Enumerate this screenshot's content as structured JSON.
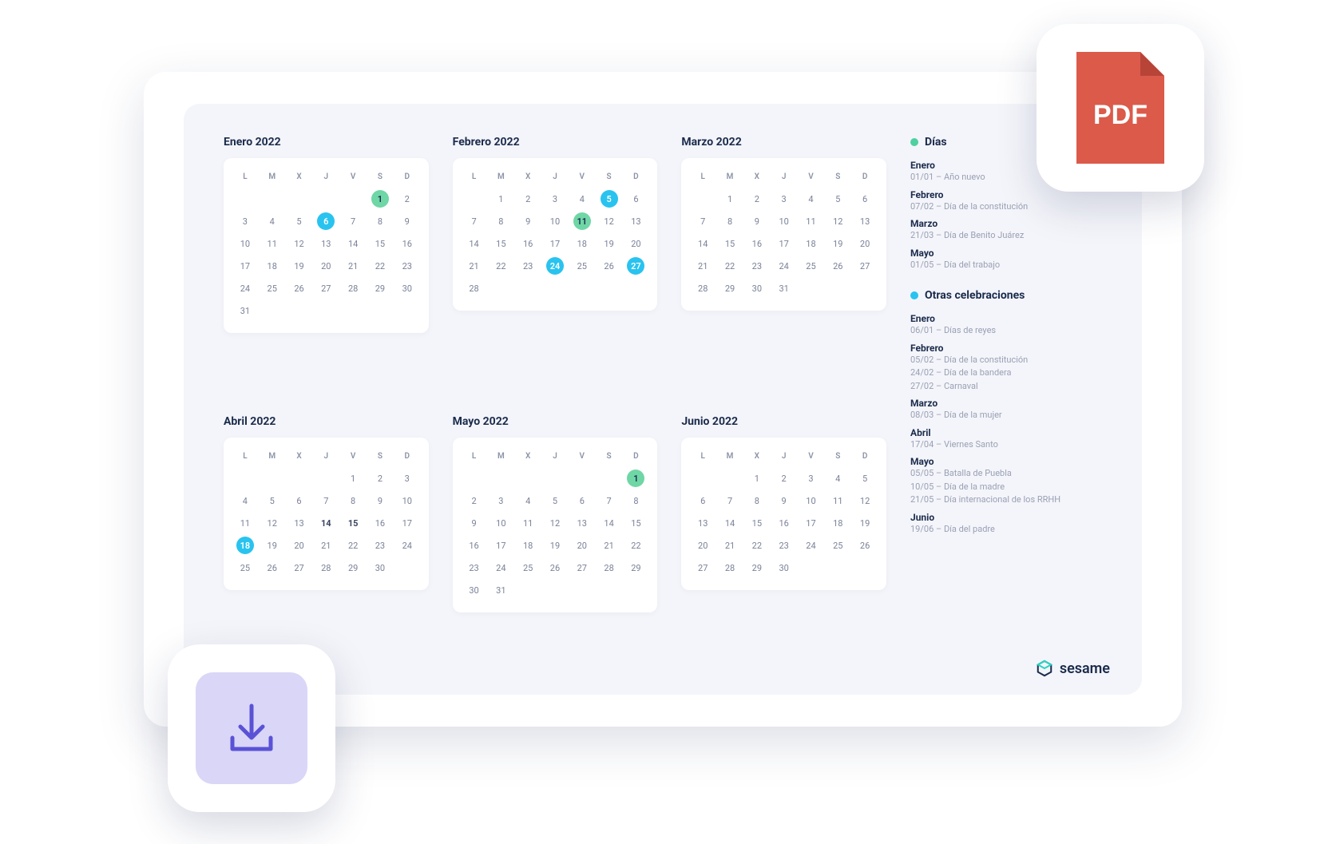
{
  "dow": [
    "L",
    "M",
    "X",
    "J",
    "V",
    "S",
    "D"
  ],
  "colors": {
    "green": "#6fd6a5",
    "blue": "#29c3ef"
  },
  "months": [
    {
      "title": "Enero 2022",
      "startDow": 5,
      "numDays": 31,
      "highlights": [
        {
          "day": 1,
          "color": "green"
        },
        {
          "day": 6,
          "color": "blue"
        }
      ]
    },
    {
      "title": "Febrero 2022",
      "startDow": 1,
      "numDays": 28,
      "highlights": [
        {
          "day": 5,
          "color": "blue"
        },
        {
          "day": 11,
          "color": "green"
        },
        {
          "day": 24,
          "color": "blue"
        },
        {
          "day": 27,
          "color": "blue"
        }
      ]
    },
    {
      "title": "Marzo 2022",
      "startDow": 1,
      "numDays": 31,
      "highlights": []
    },
    {
      "title": "Abril 2022",
      "startDow": 4,
      "numDays": 30,
      "boldDays": [
        14,
        15
      ],
      "highlights": [
        {
          "day": 18,
          "color": "blue"
        }
      ]
    },
    {
      "title": "Mayo 2022",
      "startDow": 6,
      "numDays": 31,
      "highlights": [
        {
          "day": 1,
          "color": "green"
        }
      ]
    },
    {
      "title": "Junio 2022",
      "startDow": 2,
      "numDays": 30,
      "highlights": []
    }
  ],
  "legend": [
    {
      "color": "green",
      "title": "Días",
      "groups": [
        {
          "month": "Enero",
          "events": [
            "01/01 – Año nuevo"
          ]
        },
        {
          "month": "Febrero",
          "events": [
            "07/02 – Día de la constitución"
          ]
        },
        {
          "month": "Marzo",
          "events": [
            "21/03 – Día de Benito Juárez"
          ]
        },
        {
          "month": "Mayo",
          "events": [
            "01/05 – Día del trabajo"
          ]
        }
      ]
    },
    {
      "color": "blue",
      "title": "Otras celebraciones",
      "groups": [
        {
          "month": "Enero",
          "events": [
            "06/01 – Días de reyes"
          ]
        },
        {
          "month": "Febrero",
          "events": [
            "05/02 – Día de la constitución",
            "24/02 – Día de la bandera",
            "27/02 – Carnaval"
          ]
        },
        {
          "month": "Marzo",
          "events": [
            "08/03 – Día de la mujer"
          ]
        },
        {
          "month": "Abril",
          "events": [
            "17/04 – Viernes Santo"
          ]
        },
        {
          "month": "Mayo",
          "events": [
            "05/05 – Batalla de Puebla",
            "10/05 – Día de la madre",
            "21/05 – Día internacional de los RRHH"
          ]
        },
        {
          "month": "Junio",
          "events": [
            "19/06 – Día del padre"
          ]
        }
      ]
    }
  ],
  "brand": "sesame",
  "pdfLabel": "PDF"
}
